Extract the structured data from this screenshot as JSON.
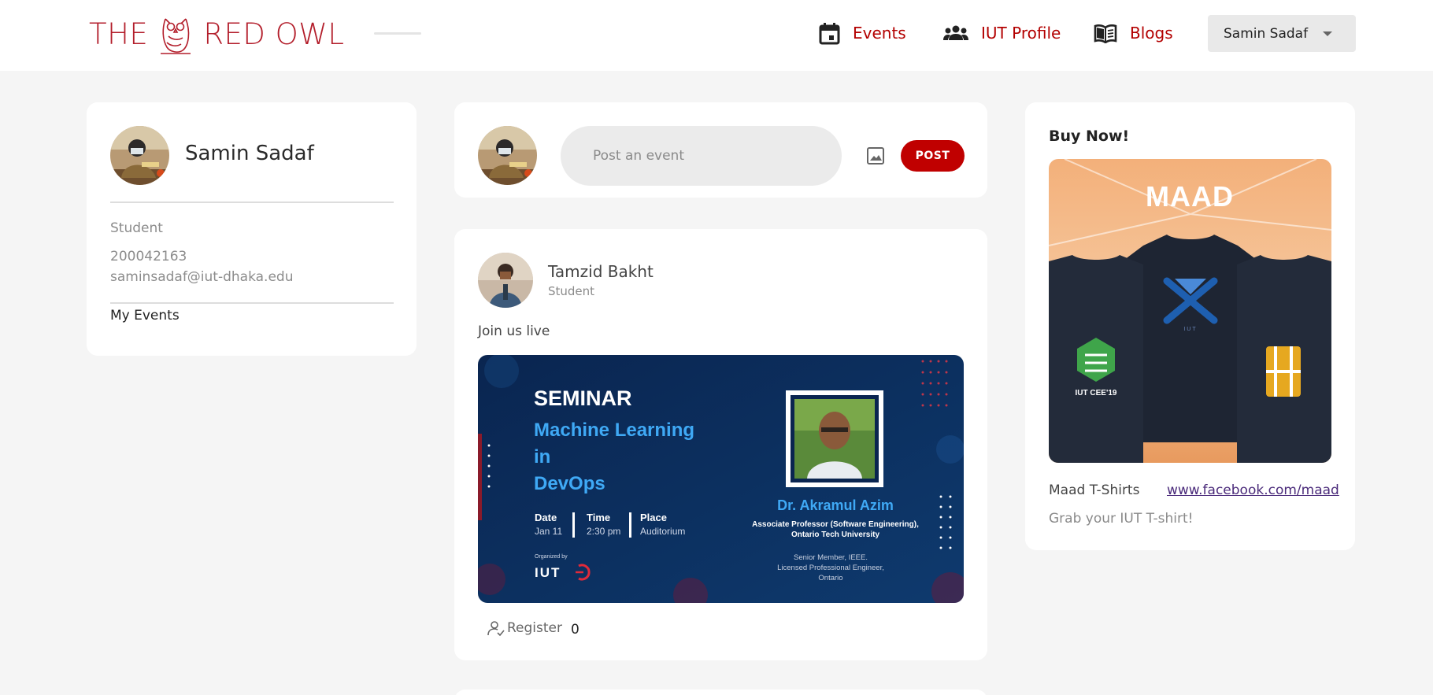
{
  "header": {
    "logo_left": "THE",
    "logo_right": "RED OWL",
    "nav": [
      {
        "label": "Events",
        "icon": "calendar-icon"
      },
      {
        "label": "IUT Profile",
        "icon": "people-group-icon"
      },
      {
        "label": "Blogs",
        "icon": "open-book-icon"
      }
    ],
    "user_menu": {
      "selected": "Samin Sadaf"
    }
  },
  "profile": {
    "name": "Samin Sadaf",
    "role": "Student",
    "student_id": "200042163",
    "email": "saminsadaf@iut-dhaka.edu",
    "my_events_label": "My Events"
  },
  "composer": {
    "placeholder": "Post an event",
    "post_label": "POST",
    "image_icon": "image-icon"
  },
  "post": {
    "author": "Tamzid Bakht",
    "author_role": "Student",
    "text": "Join us live",
    "register_label": "Register",
    "register_count": "0",
    "poster": {
      "heading": "SEMINAR",
      "topic_lines": [
        "Machine Learning",
        "in",
        "DevOps"
      ],
      "date_label": "Date",
      "date_value": "Jan 11",
      "time_label": "Time",
      "time_value": "2:30 pm",
      "place_label": "Place",
      "place_value": "Auditorium",
      "organized_by": "Organized by",
      "org_name": "IUT",
      "speaker": "Dr. Akramul Azim",
      "speaker_title_lines": [
        "Associate Professor (Software Engineering),",
        "Ontario Tech University"
      ],
      "speaker_extra_lines": [
        "Senior Member, IEEE.",
        "Licensed Professional Engineer,",
        "Ontario"
      ]
    }
  },
  "sidebar_ad": {
    "title": "Buy Now!",
    "product_name": "Maad T-Shirts",
    "link_text": "www.facebook.com/maad",
    "description": "Grab your IUT T-shirt!",
    "image_brand": "MAAD",
    "shirt_left_text": "IUT CEE'19",
    "shirt_center_text": "IUT"
  },
  "colors": {
    "brand_red": "#b31e2b",
    "nav_red": "#b30000",
    "button_red": "#c00000",
    "page_bg": "#f5f5f5",
    "poster_bg": "#0e2f5c",
    "poster_accent": "#3fa9f5"
  }
}
